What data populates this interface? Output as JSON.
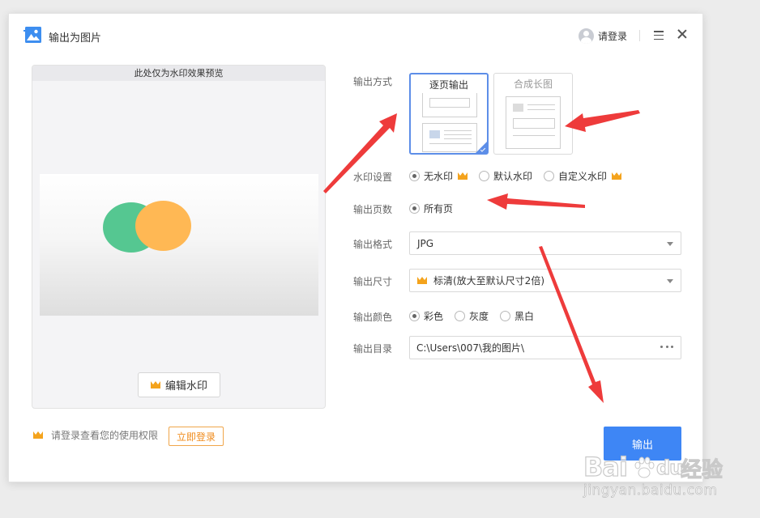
{
  "titlebar": {
    "title": "输出为图片",
    "login_label": "请登录"
  },
  "preview": {
    "header": "此处仅为水印效果预览",
    "edit_watermark_label": "编辑水印"
  },
  "output_mode": {
    "label": "输出方式",
    "options": [
      "逐页输出",
      "合成长图"
    ],
    "selected": "逐页输出"
  },
  "watermark": {
    "label": "水印设置",
    "options": [
      {
        "label": "无水印",
        "checked": true,
        "premium": true
      },
      {
        "label": "默认水印",
        "checked": false,
        "premium": false
      },
      {
        "label": "自定义水印",
        "checked": false,
        "premium": true
      }
    ]
  },
  "pages": {
    "label": "输出页数",
    "options": [
      {
        "label": "所有页",
        "checked": true
      }
    ]
  },
  "format": {
    "label": "输出格式",
    "value": "JPG"
  },
  "size": {
    "label": "输出尺寸",
    "value": "标清(放大至默认尺寸2倍)"
  },
  "color": {
    "label": "输出颜色",
    "options": [
      {
        "label": "彩色",
        "checked": true
      },
      {
        "label": "灰度",
        "checked": false
      },
      {
        "label": "黑白",
        "checked": false
      }
    ]
  },
  "directory": {
    "label": "输出目录",
    "value": "C:\\Users\\007\\我的图片\\"
  },
  "footer": {
    "login_hint": "请登录查看您的使用权限",
    "login_now_label": "立即登录",
    "export_label": "输出"
  },
  "overlay_watermark": {
    "brand": "Bai",
    "brand_suffix": "du",
    "cn": "经验",
    "url": "jingyan.baidu.com"
  },
  "colors": {
    "accent": "#3e86f5",
    "selected_border": "#5d8ee8",
    "premium": "#f4a31c",
    "arrow": "#ee3b3b",
    "preview_green": "#55c791",
    "preview_orange": "#ffb854"
  }
}
